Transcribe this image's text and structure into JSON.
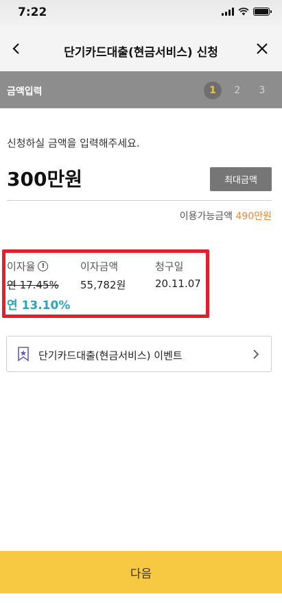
{
  "status": {
    "time": "7:22"
  },
  "header": {
    "title": "단기카드대출(현금서비스) 신청"
  },
  "steps": {
    "label": "금액입력",
    "items": [
      "1",
      "2",
      "3"
    ],
    "active_index": 0
  },
  "form": {
    "prompt": "신청하실 금액을 입력해주세요.",
    "amount": "300만원",
    "max_button": "최대금액",
    "available_label": "이용가능금액",
    "available_value": "490만원"
  },
  "rates": {
    "rate_header": "이자율",
    "interest_header": "이자금액",
    "billing_header": "청구일",
    "old_rate": "연 17.45%",
    "new_rate": "연 13.10%",
    "interest_amount": "55,782원",
    "billing_date": "20.11.07",
    "highlight_color": "#e2202b",
    "new_rate_color": "#2aa3c3"
  },
  "event": {
    "label": "단기카드대출(현금서비스) 이벤트"
  },
  "footer": {
    "next_button": "다음",
    "button_color": "#f7c841"
  }
}
